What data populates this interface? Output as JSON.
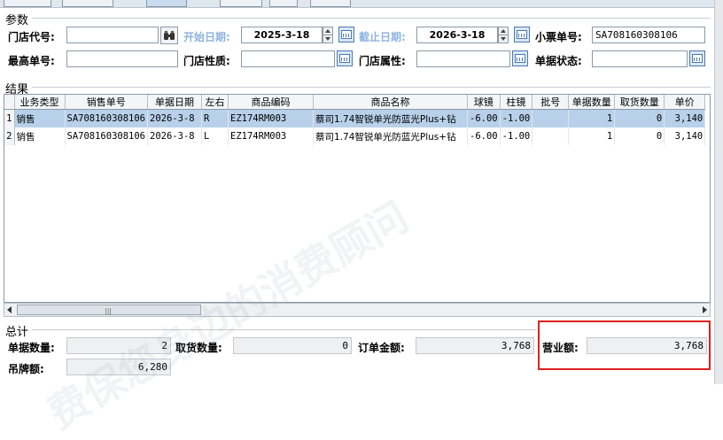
{
  "params": {
    "title": "参数",
    "store_code_label": "门店代号:",
    "start_date_label": "开始日期:",
    "start_date": "2025-3-18",
    "end_date_label": "截止日期:",
    "end_date": "2026-3-18",
    "ticket_label": "小票单号:",
    "ticket_value": "SA708160308106",
    "max_no_label": "最高单号:",
    "store_nature_label": "门店性质:",
    "store_attr_label": "门店属性:",
    "doc_status_label": "单据状态:"
  },
  "results": {
    "title": "结果",
    "columns": [
      "业务类型",
      "销售单号",
      "单据日期",
      "左右",
      "商品编码",
      "商品名称",
      "球镜",
      "柱镜",
      "批号",
      "单据数量",
      "取货数量",
      "单价"
    ],
    "rows": [
      {
        "idx": "1",
        "type": "销售",
        "order": "SA708160308106",
        "date": "2026-3-8",
        "lr": "R",
        "code": "EZ174RM003",
        "name": "蔡司1.74智锐单光防蓝光Plus+钻",
        "sph": "-6.00",
        "cyl": "-1.00",
        "batch": "",
        "qty": "1",
        "pick": "0",
        "price": "3,140"
      },
      {
        "idx": "2",
        "type": "销售",
        "order": "SA708160308106",
        "date": "2026-3-8",
        "lr": "L",
        "code": "EZ174RM003",
        "name": "蔡司1.74智锐单光防蓝光Plus+钻",
        "sph": "-6.00",
        "cyl": "-1.00",
        "batch": "",
        "qty": "1",
        "pick": "0",
        "price": "3,140"
      }
    ]
  },
  "totals": {
    "title": "总计",
    "doc_qty_label": "单据数量:",
    "doc_qty": "2",
    "pick_qty_label": "取货数量:",
    "pick_qty": "0",
    "order_amount_label": "订单金额:",
    "order_amount": "3,768",
    "revenue_label": "营业额:",
    "revenue": "3,768",
    "tag_price_label": "吊牌额:",
    "tag_price": "6,280"
  },
  "watermark": "费保您身边的消费顾问",
  "colors": {
    "highlight": "#e02020",
    "selected_row": "#b8d0ea",
    "dim_label": "#8fb3e0"
  }
}
